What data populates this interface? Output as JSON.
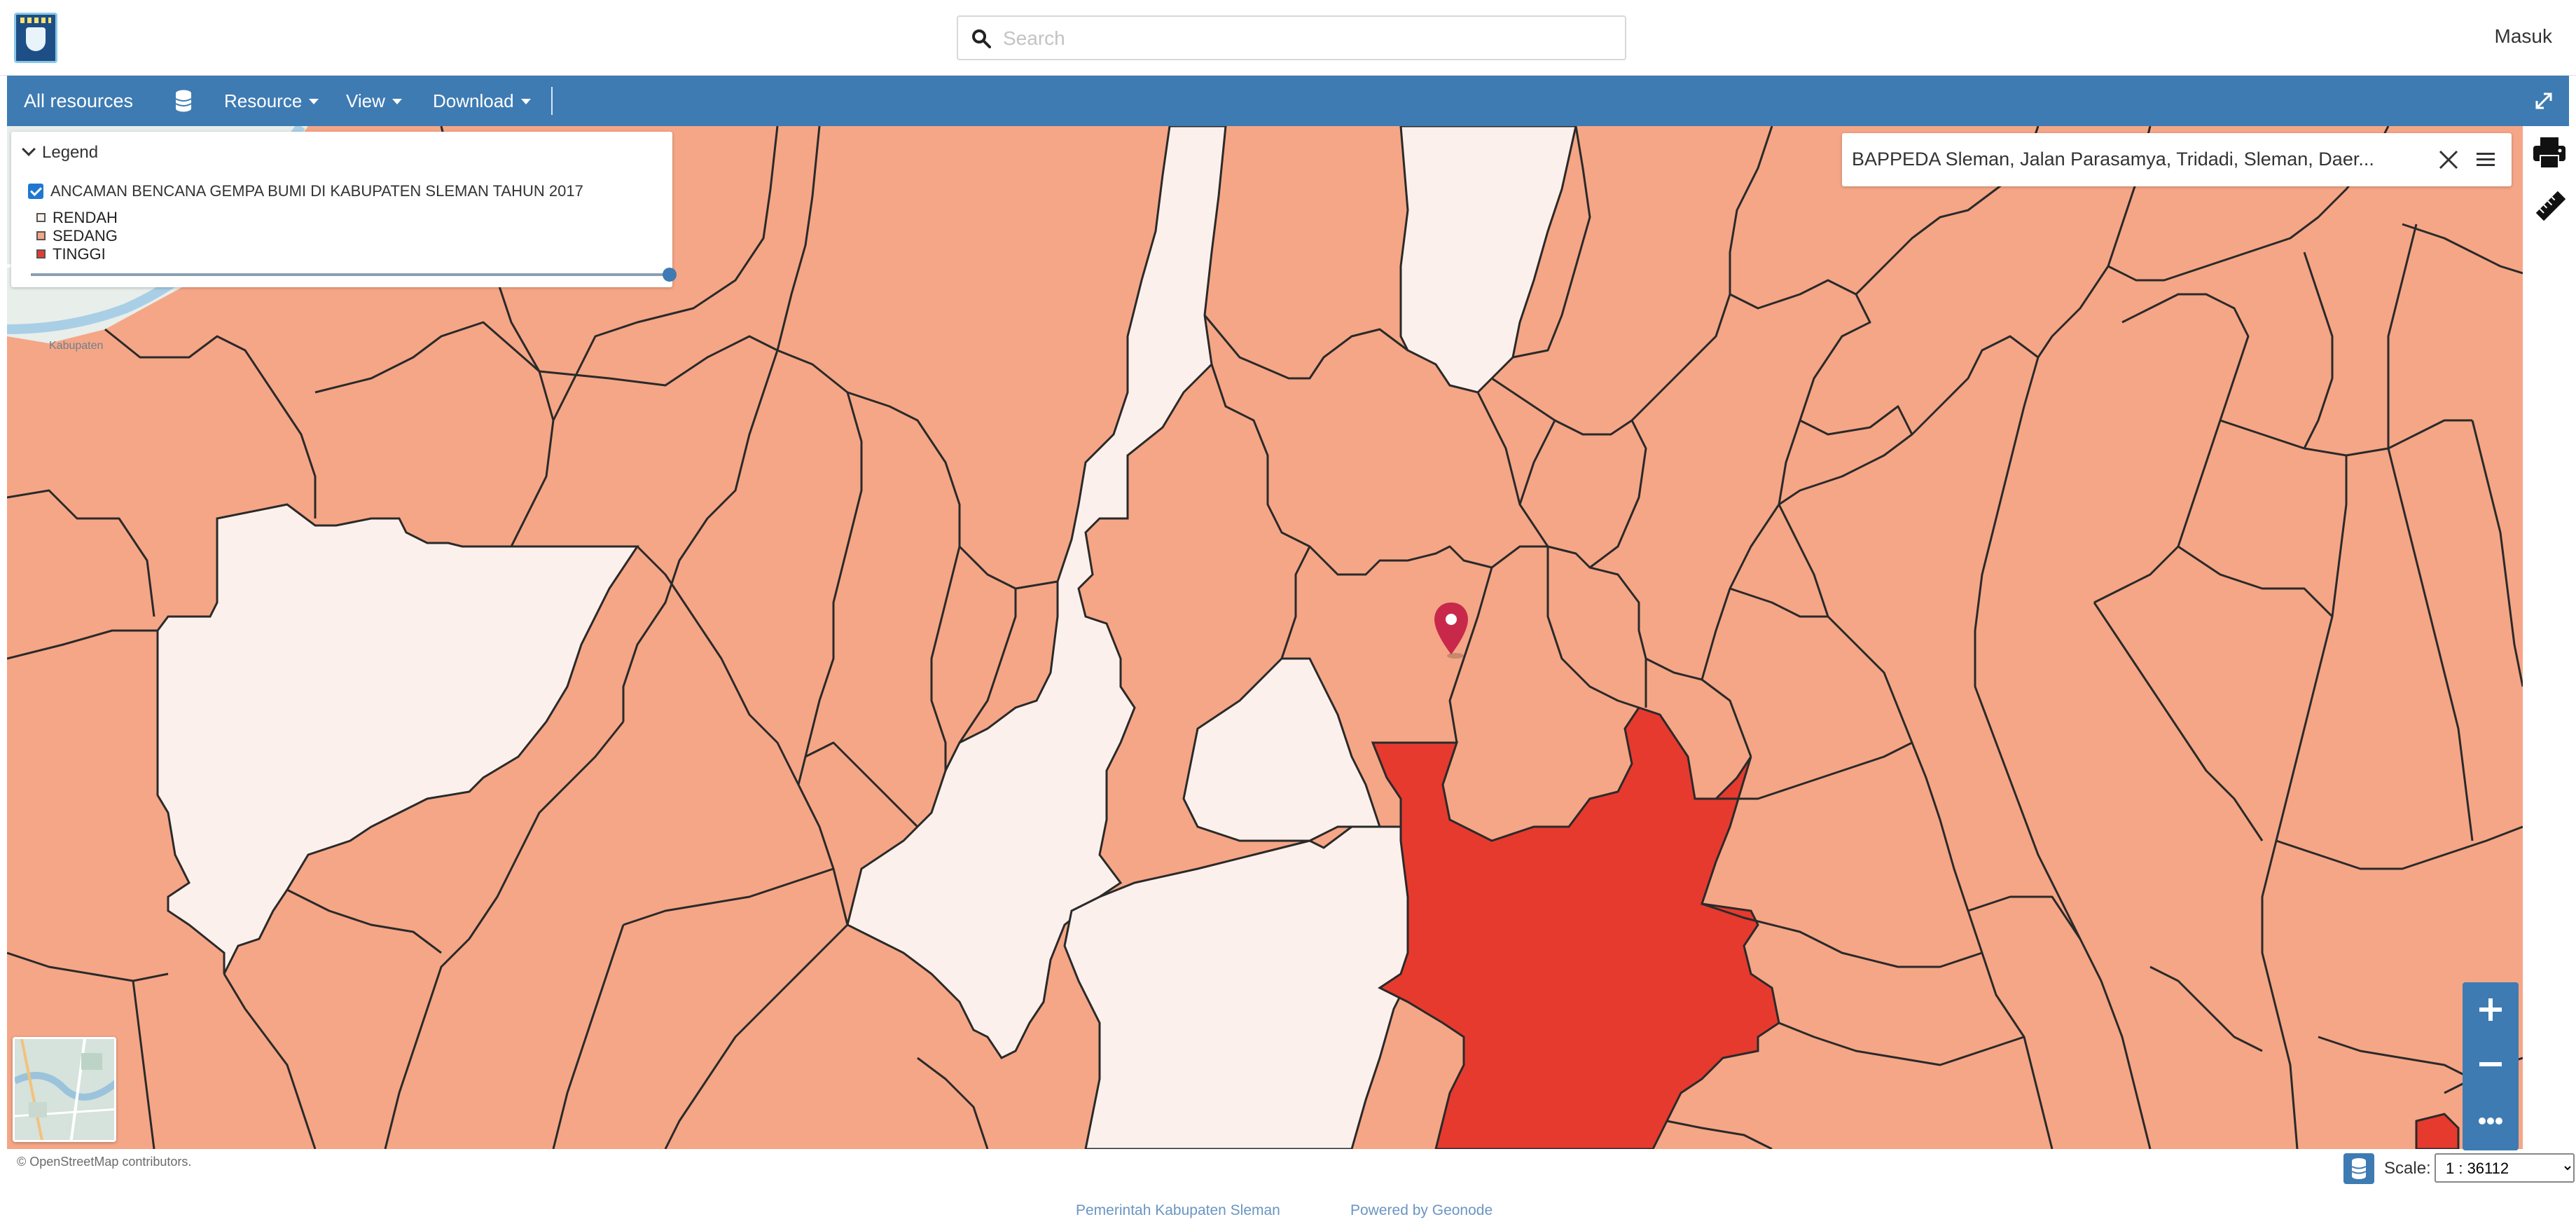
{
  "header": {
    "search_placeholder": "Search",
    "login_label": "Masuk"
  },
  "nav": {
    "all_resources": "All resources",
    "resource": "Resource",
    "view": "View",
    "download": "Download"
  },
  "legend": {
    "title": "Legend",
    "layer_name": "ANCAMAN BENCANA GEMPA BUMI DI KABUPATEN SLEMAN TAHUN 2017",
    "layer_visible": true,
    "opacity": 1.0,
    "classes": [
      {
        "label": "RENDAH",
        "color": "#fcf0ec"
      },
      {
        "label": "SEDANG",
        "color": "#f5a686"
      },
      {
        "label": "TINGGI",
        "color": "#e63a2e"
      }
    ]
  },
  "geocoder": {
    "result_text": "BAPPEDA Sleman, Jalan Parasamya, Tridadi, Sleman, Daer..."
  },
  "map": {
    "attribution": "© OpenStreetMap contributors.",
    "base_label": "Kabupaten",
    "marker_color": "#c8294a",
    "colors": {
      "low": "#fcf0ec",
      "medium": "#f5a686",
      "high": "#e63a2e",
      "boundary": "#2a2a2a",
      "basemap": "#e8eeea",
      "river": "#a9cfe6"
    }
  },
  "controls": {
    "zoom_in": "+",
    "zoom_out": "−",
    "more": "•••",
    "scale_label": "Scale:",
    "scale_value": "1 : 36112"
  },
  "footer": {
    "link_pemkab": "Pemerintah Kabupaten Sleman",
    "link_powered": "Powered by Geonode"
  },
  "icons": [
    "search-icon",
    "database-icon",
    "expand-icon",
    "print-icon",
    "ruler-icon",
    "close-icon",
    "menu-icon",
    "map-marker-icon",
    "layers-icon"
  ]
}
